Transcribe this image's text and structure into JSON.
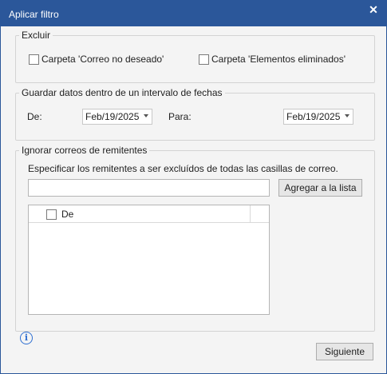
{
  "window": {
    "title": "Aplicar filtro",
    "close_glyph": "✕"
  },
  "exclude": {
    "legend": "Excluir",
    "junk_folder": "Carpeta 'Correo no deseado'",
    "deleted_folder": "Carpeta 'Elementos eliminados'"
  },
  "date_range": {
    "legend": "Guardar datos dentro de un intervalo de fechas",
    "from_label": "De:",
    "from_value": "Feb/19/2025",
    "to_label": "Para:",
    "to_value": "Feb/19/2025"
  },
  "ignore_senders": {
    "legend": "Ignorar correos de remitentes",
    "instruction": "Especificar los remitentes a ser excluídos de todas las casillas de correo.",
    "sender_input_value": "",
    "add_button": "Agregar a la lista",
    "column_header": "De"
  },
  "footer": {
    "info_glyph": "i",
    "next_button": "Siguiente"
  },
  "colors": {
    "titlebar": "#2b579a",
    "info": "#2f6fd1"
  }
}
